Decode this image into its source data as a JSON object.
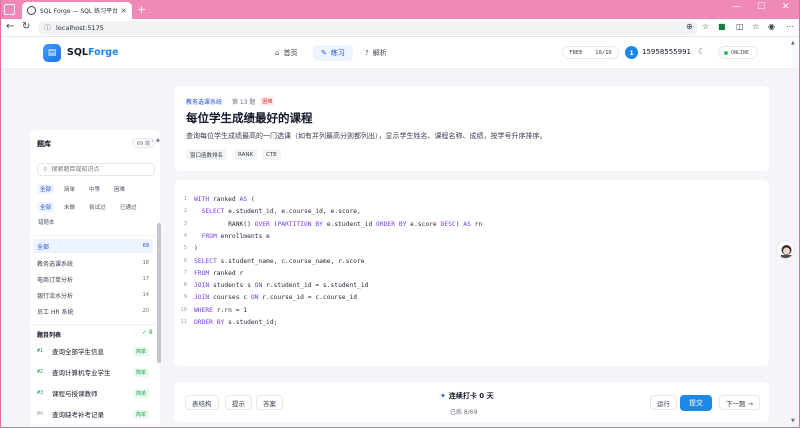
{
  "browser": {
    "tab_title": "SQL Forge — SQL 练习平台",
    "url": "localhost:5175",
    "new_tab": "+",
    "close_tab": "×",
    "win_min": "—",
    "win_max": "☐",
    "win_close": "✕"
  },
  "header": {
    "logo_prefix": "SQL",
    "logo_suffix": "Forge",
    "nav": [
      {
        "label": "首页",
        "icon": "home-icon",
        "active": false
      },
      {
        "label": "练习",
        "icon": "pen-icon",
        "active": true
      },
      {
        "label": "解析",
        "icon": "help-icon",
        "active": false
      }
    ],
    "plan_label": "FREE",
    "plan_quota": "10/10",
    "user_badge": "1",
    "user_phone": "15958555991",
    "status": "ONLINE"
  },
  "sidebar": {
    "title": "题库",
    "count": "69 题",
    "search_placeholder": "搜索题目或知识点",
    "difficulty_filters": [
      "全部",
      "简单",
      "中等",
      "困难"
    ],
    "status_filters": [
      "全部",
      "未做",
      "尝试过",
      "已通过",
      "错题本"
    ],
    "categories": [
      {
        "name": "全部",
        "count": "69",
        "active": true
      },
      {
        "name": "教务选课系统",
        "count": "18",
        "active": false
      },
      {
        "name": "电商订单分析",
        "count": "17",
        "active": false
      },
      {
        "name": "银行流水分析",
        "count": "14",
        "active": false
      },
      {
        "name": "员工 HR 系统",
        "count": "20",
        "active": false
      }
    ],
    "problem_list_title": "题目列表",
    "problem_list_done": "✓ 8",
    "problems": [
      {
        "num": "#1",
        "title": "查询全部学生信息",
        "level": "简单",
        "done": true
      },
      {
        "num": "#2",
        "title": "查询计算机专业学生",
        "level": "简单",
        "done": true
      },
      {
        "num": "#3",
        "title": "课程与授课教师",
        "level": "简单",
        "done": true
      },
      {
        "num": "#4",
        "title": "查询缺考补考记录",
        "level": "简单",
        "done": false
      }
    ]
  },
  "problem": {
    "category": "教务选课系统",
    "index": "第 13 题",
    "difficulty": "困难",
    "title": "每位学生成绩最好的课程",
    "description": "查询每位学生成绩最高的一门选课（如有并列最高分则都列出），显示学生姓名、课程名称、成绩，按学号升序排序。",
    "tags": [
      "窗口函数排名",
      "RANK",
      "CTE"
    ]
  },
  "editor": {
    "lines": [
      "WITH ranked AS (",
      "  SELECT e.student_id, e.course_id, e.score,",
      "         RANK() OVER (PARTITION BY e.student_id ORDER BY e.score DESC) AS rn",
      "  FROM enrollments e",
      ")",
      "SELECT s.student_name, c.course_name, r.score",
      "FROM ranked r",
      "JOIN students s ON r.student_id = s.student_id",
      "JOIN courses c ON r.course_id = c.course_id",
      "WHERE r.rn = 1",
      "ORDER BY s.student_id;"
    ]
  },
  "actions": {
    "schema": "表结构",
    "hint": "提示",
    "answer": "答案",
    "streak": "连续打卡 0 天",
    "solved": "已练 8/69",
    "run": "运行",
    "submit": "提交",
    "next": "下一题 →"
  },
  "colors": {
    "accent": "#1e88e5",
    "browser_frame": "#ef8ab6",
    "success": "#16a34a",
    "danger": "#dc2626",
    "keyword": "#7c3aed"
  }
}
